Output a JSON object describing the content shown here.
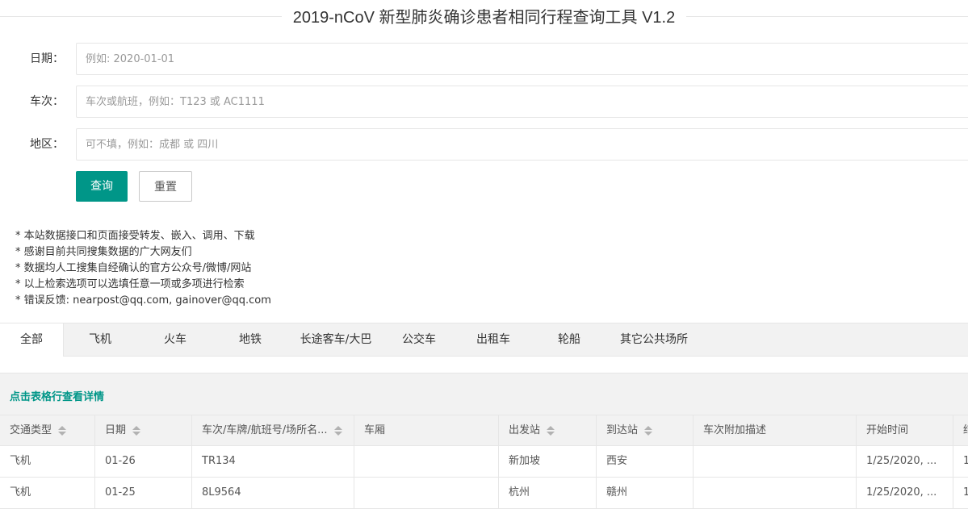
{
  "header": {
    "title": "2019-nCoV 新型肺炎确诊患者相同行程查询工具 V1.2"
  },
  "form": {
    "date_label": "日期：",
    "date_placeholder": "例如: 2020-01-01",
    "train_label": "车次：",
    "train_placeholder": "车次或航班，例如：T123 或 AC1111",
    "region_label": "地区：",
    "region_placeholder": "可不填，例如：成都 或 四川",
    "search_label": "查询",
    "reset_label": "重置"
  },
  "notes": [
    "* 本站数据接口和页面接受转发、嵌入、调用、下载",
    "* 感谢目前共同搜集数据的广大网友们",
    "* 数据均人工搜集自经确认的官方公众号/微博/网站",
    "* 以上检索选项可以选填任意一项或多项进行检索",
    "* 错误反馈: nearpost@qq.com, gainover@qq.com"
  ],
  "tabs": [
    "全部",
    "飞机",
    "火车",
    "地铁",
    "长途客车/大巴",
    "公交车",
    "出租车",
    "轮船",
    "其它公共场所"
  ],
  "table_hint": "点击表格行查看详情",
  "table": {
    "columns": [
      "交通类型",
      "日期",
      "车次/车牌/航班号/场所名...",
      "车厢",
      "出发站",
      "到达站",
      "车次附加描述",
      "开始时间",
      "结"
    ],
    "rows": [
      [
        "飞机",
        "01-26",
        "TR134",
        "",
        "新加坡",
        "西安",
        "",
        "1/25/2020, ...",
        "1"
      ],
      [
        "飞机",
        "01-25",
        "8L9564",
        "",
        "杭州",
        "赣州",
        "",
        "1/25/2020, ...",
        "1"
      ]
    ]
  }
}
